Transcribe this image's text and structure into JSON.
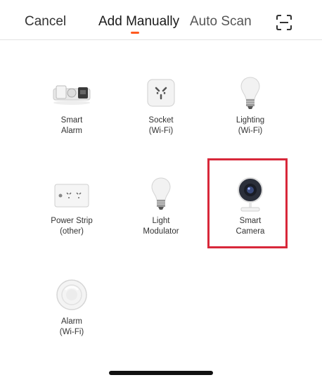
{
  "header": {
    "cancel_label": "Cancel",
    "tabs": [
      {
        "label": "Add Manually",
        "active": true
      },
      {
        "label": "Auto Scan",
        "active": false
      }
    ],
    "scan_icon": "scan-qr-icon",
    "accent_color": "#ff5a1f"
  },
  "devices": [
    {
      "line1": "Smart",
      "line2": "Alarm",
      "icon": "smart-alarm-icon"
    },
    {
      "line1": "Socket",
      "line2": "(Wi-Fi)",
      "icon": "socket-icon"
    },
    {
      "line1": "Lighting",
      "line2": "(Wi-Fi)",
      "icon": "lightbulb-icon"
    },
    {
      "line1": "Power Strip",
      "line2": "(other)",
      "icon": "power-strip-icon"
    },
    {
      "line1": "Light",
      "line2": "Modulator",
      "icon": "lightbulb-icon"
    },
    {
      "line1": "Smart",
      "line2": "Camera",
      "icon": "camera-icon",
      "highlighted": true
    },
    {
      "line1": "Alarm",
      "line2": "(Wi-Fi)",
      "icon": "alarm-icon"
    }
  ],
  "highlight_color": "#d8283a"
}
